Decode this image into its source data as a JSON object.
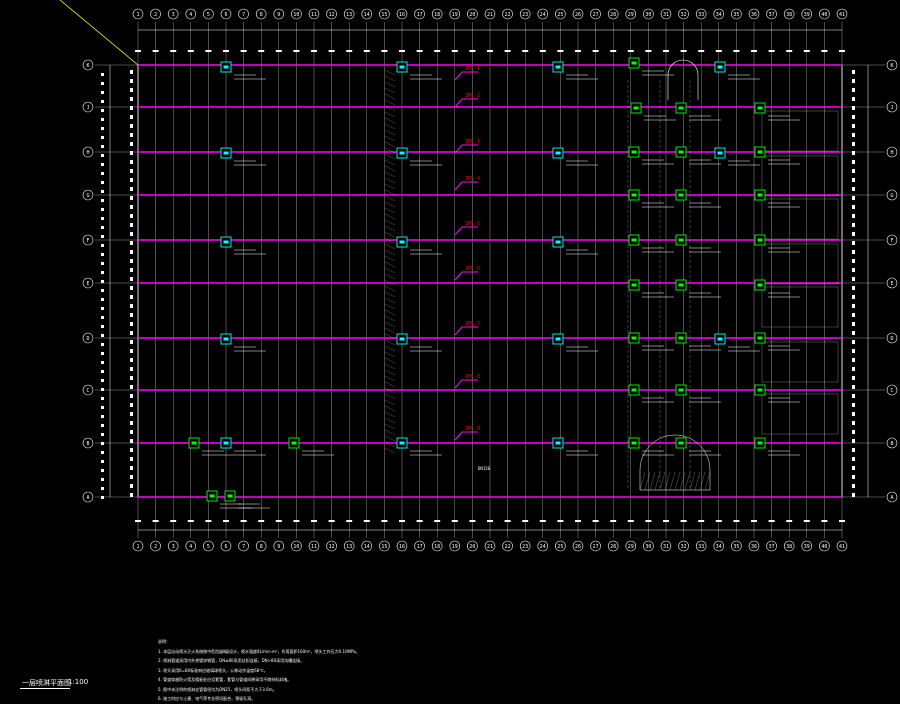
{
  "drawing": {
    "title": "一层喷淋平面图",
    "scale": "1:100",
    "notes_heading": "说明：",
    "notes": [
      "1. 本层自动喷水灭火系统按中危险级Ⅱ级设计，喷水强度8L/min·m²，作用面积160m²，喷头工作压力0.10MPa。",
      "2. 喷淋管道采用内外热镀锌钢管，DN≤80采用丝扣连接，DN>80采用沟槽连接。",
      "3. 喷头采用K=80标准响应玻璃球喷头，公称动作温度68℃。",
      "4. 管道穿越防火墙及楼板处应设套管，套管与管道间隙采用不燃材料封堵。",
      "5. 图中未注明的喷淋支管管径均为DN25，喷头间距不大于3.6m。",
      "6. 施工时应与土建、电气等专业密切配合，预留孔洞。"
    ]
  },
  "grid": {
    "columns": [
      "1",
      "2",
      "3",
      "4",
      "5",
      "6",
      "7",
      "8",
      "9",
      "10",
      "11",
      "12",
      "13",
      "14",
      "15",
      "16",
      "17",
      "18",
      "19",
      "20",
      "21",
      "22",
      "23",
      "24",
      "25",
      "26",
      "27",
      "28",
      "29",
      "30",
      "31",
      "32",
      "33",
      "34",
      "35",
      "36",
      "37",
      "38",
      "39",
      "40",
      "41"
    ],
    "rows": [
      "K",
      "J",
      "H",
      "G",
      "F",
      "E",
      "D",
      "C",
      "B",
      "A"
    ]
  },
  "valve_tags": [
    "ZPL-1",
    "ZPL-2",
    "ZPL-3",
    "ZPL-4",
    "ZPL-5",
    "ZPL-6",
    "ZPL-7",
    "ZPL-8",
    "ZPL-9"
  ],
  "pipe_label": "DN150",
  "colors": {
    "background": "#000000",
    "grid": "#ffffff",
    "sprinkler_main": "#ff00ff",
    "valve_tag": "#ff0000",
    "equipment_green": "#00ff00",
    "equipment_cyan": "#00ffff",
    "leader": "#ffff00"
  }
}
